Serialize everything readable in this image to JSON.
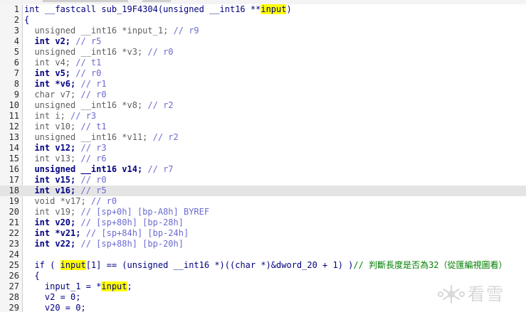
{
  "editor": {
    "line_numbers": [
      "1",
      "2",
      "3",
      "4",
      "5",
      "6",
      "7",
      "8",
      "9",
      "10",
      "11",
      "12",
      "13",
      "14",
      "15",
      "16",
      "17",
      "18",
      "19",
      "20",
      "21",
      "22",
      "23",
      "24",
      "25",
      "26",
      "27",
      "28",
      "29"
    ],
    "current_line": 18,
    "highlight_color": "#ffff00",
    "current_line_color": "#e4e4e4"
  },
  "lines": [
    {
      "tokens": [
        {
          "c": "t-name",
          "t": "int __fastcall sub_19F4304(unsigned __int16 **"
        },
        {
          "c": "t-hl",
          "t": "input"
        },
        {
          "c": "t-name",
          "t": ")"
        }
      ]
    },
    {
      "tokens": [
        {
          "c": "t-name",
          "t": "{"
        }
      ]
    },
    {
      "tokens": [
        {
          "c": "t-plain",
          "t": "  unsigned __int16 *input_1; "
        },
        {
          "c": "t-cmt",
          "t": "// r9"
        }
      ]
    },
    {
      "tokens": [
        {
          "c": "t-bold",
          "t": "  int v2; "
        },
        {
          "c": "t-cmt",
          "t": "// r5"
        }
      ]
    },
    {
      "tokens": [
        {
          "c": "t-plain",
          "t": "  unsigned __int16 *v3; "
        },
        {
          "c": "t-cmt",
          "t": "// r0"
        }
      ]
    },
    {
      "tokens": [
        {
          "c": "t-plain",
          "t": "  int v4; "
        },
        {
          "c": "t-cmt",
          "t": "// t1"
        }
      ]
    },
    {
      "tokens": [
        {
          "c": "t-bold",
          "t": "  int v5; "
        },
        {
          "c": "t-cmt",
          "t": "// r0"
        }
      ]
    },
    {
      "tokens": [
        {
          "c": "t-bold",
          "t": "  int *v6; "
        },
        {
          "c": "t-cmt",
          "t": "// r1"
        }
      ]
    },
    {
      "tokens": [
        {
          "c": "t-plain",
          "t": "  char v7; "
        },
        {
          "c": "t-cmt",
          "t": "// r0"
        }
      ]
    },
    {
      "tokens": [
        {
          "c": "t-plain",
          "t": "  unsigned __int16 *v8; "
        },
        {
          "c": "t-cmt",
          "t": "// r2"
        }
      ]
    },
    {
      "tokens": [
        {
          "c": "t-plain",
          "t": "  int i; "
        },
        {
          "c": "t-cmt",
          "t": "// r3"
        }
      ]
    },
    {
      "tokens": [
        {
          "c": "t-plain",
          "t": "  int v10; "
        },
        {
          "c": "t-cmt",
          "t": "// t1"
        }
      ]
    },
    {
      "tokens": [
        {
          "c": "t-plain",
          "t": "  unsigned __int16 *v11; "
        },
        {
          "c": "t-cmt",
          "t": "// r2"
        }
      ]
    },
    {
      "tokens": [
        {
          "c": "t-bold",
          "t": "  int v12; "
        },
        {
          "c": "t-cmt",
          "t": "// r3"
        }
      ]
    },
    {
      "tokens": [
        {
          "c": "t-plain",
          "t": "  int v13; "
        },
        {
          "c": "t-cmt",
          "t": "// r6"
        }
      ]
    },
    {
      "tokens": [
        {
          "c": "t-bold",
          "t": "  unsigned __int16 v14; "
        },
        {
          "c": "t-cmt",
          "t": "// r7"
        }
      ]
    },
    {
      "tokens": [
        {
          "c": "t-bold",
          "t": "  int v15; "
        },
        {
          "c": "t-cmt",
          "t": "// r0"
        }
      ]
    },
    {
      "tokens": [
        {
          "c": "t-bold",
          "t": "  int v16; "
        },
        {
          "c": "t-cmt",
          "t": "// r5"
        }
      ]
    },
    {
      "tokens": [
        {
          "c": "t-plain",
          "t": "  void *v17; "
        },
        {
          "c": "t-cmt",
          "t": "// r0"
        }
      ]
    },
    {
      "tokens": [
        {
          "c": "t-plain",
          "t": "  int v19; "
        },
        {
          "c": "t-cmt",
          "t": "// [sp+0h] [bp-A8h] BYREF"
        }
      ]
    },
    {
      "tokens": [
        {
          "c": "t-bold",
          "t": "  int v20; "
        },
        {
          "c": "t-cmt",
          "t": "// [sp+80h] [bp-28h]"
        }
      ]
    },
    {
      "tokens": [
        {
          "c": "t-bold",
          "t": "  int *v21; "
        },
        {
          "c": "t-cmt",
          "t": "// [sp+84h] [bp-24h]"
        }
      ]
    },
    {
      "tokens": [
        {
          "c": "t-bold",
          "t": "  int v22; "
        },
        {
          "c": "t-cmt",
          "t": "// [sp+88h] [bp-20h]"
        }
      ]
    },
    {
      "tokens": []
    },
    {
      "tokens": [
        {
          "c": "t-name",
          "t": "  if ( "
        },
        {
          "c": "t-hl",
          "t": "input"
        },
        {
          "c": "t-name",
          "t": "[1] == (unsigned __int16 *)((char *)&"
        },
        {
          "c": "t-lbl",
          "t": "dword_20"
        },
        {
          "c": "t-name",
          "t": " + 1) )"
        },
        {
          "c": "t-green",
          "t": "// 判斷長度是否為32（從匯編視圖看）"
        }
      ]
    },
    {
      "tokens": [
        {
          "c": "t-name",
          "t": "  {"
        }
      ]
    },
    {
      "tokens": [
        {
          "c": "t-name",
          "t": "    input_1 = *"
        },
        {
          "c": "t-hl",
          "t": "input"
        },
        {
          "c": "t-name",
          "t": ";"
        }
      ]
    },
    {
      "tokens": [
        {
          "c": "t-name",
          "t": "    v2 = 0;"
        }
      ]
    },
    {
      "tokens": [
        {
          "c": "t-name",
          "t": "    v20 = 0;"
        }
      ]
    }
  ],
  "watermark": {
    "text": "看雪",
    "icon": "snowflake-icon",
    "color": "#b8b8b8"
  }
}
